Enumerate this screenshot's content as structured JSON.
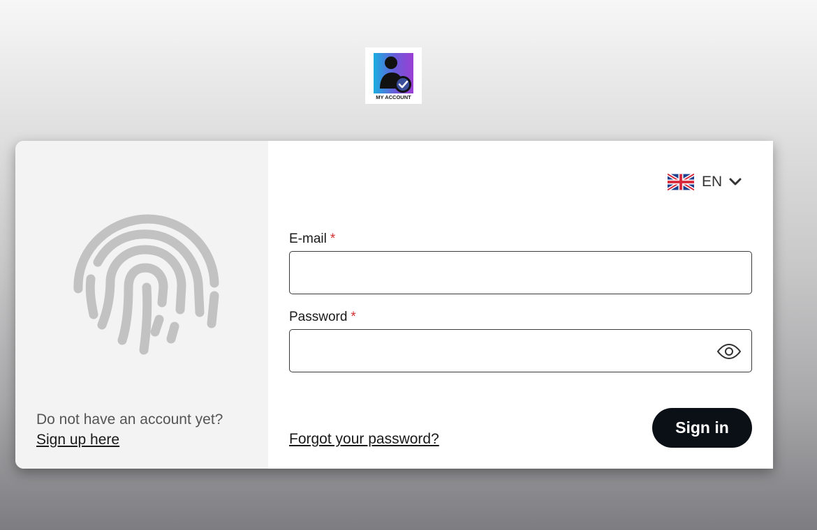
{
  "logo": {
    "caption": "MY ACCOUNT",
    "icon": "user-verified-icon",
    "gradient_start": "#19aee0",
    "gradient_end": "#9b3fd4"
  },
  "left_panel": {
    "icon": "fingerprint-icon",
    "prompt": "Do not have an account yet?",
    "signup_link": "Sign up here"
  },
  "language": {
    "flag": "uk-flag-icon",
    "code": "EN"
  },
  "form": {
    "email": {
      "label": "E-mail",
      "required_mark": "*",
      "value": "",
      "placeholder": ""
    },
    "password": {
      "label": "Password",
      "required_mark": "*",
      "value": "",
      "placeholder": ""
    },
    "forgot_link": "Forgot your password?",
    "submit_label": "Sign in"
  },
  "colors": {
    "button_bg": "#0b1017",
    "required": "#d32f2f",
    "fingerprint": "#c2c2c2"
  }
}
